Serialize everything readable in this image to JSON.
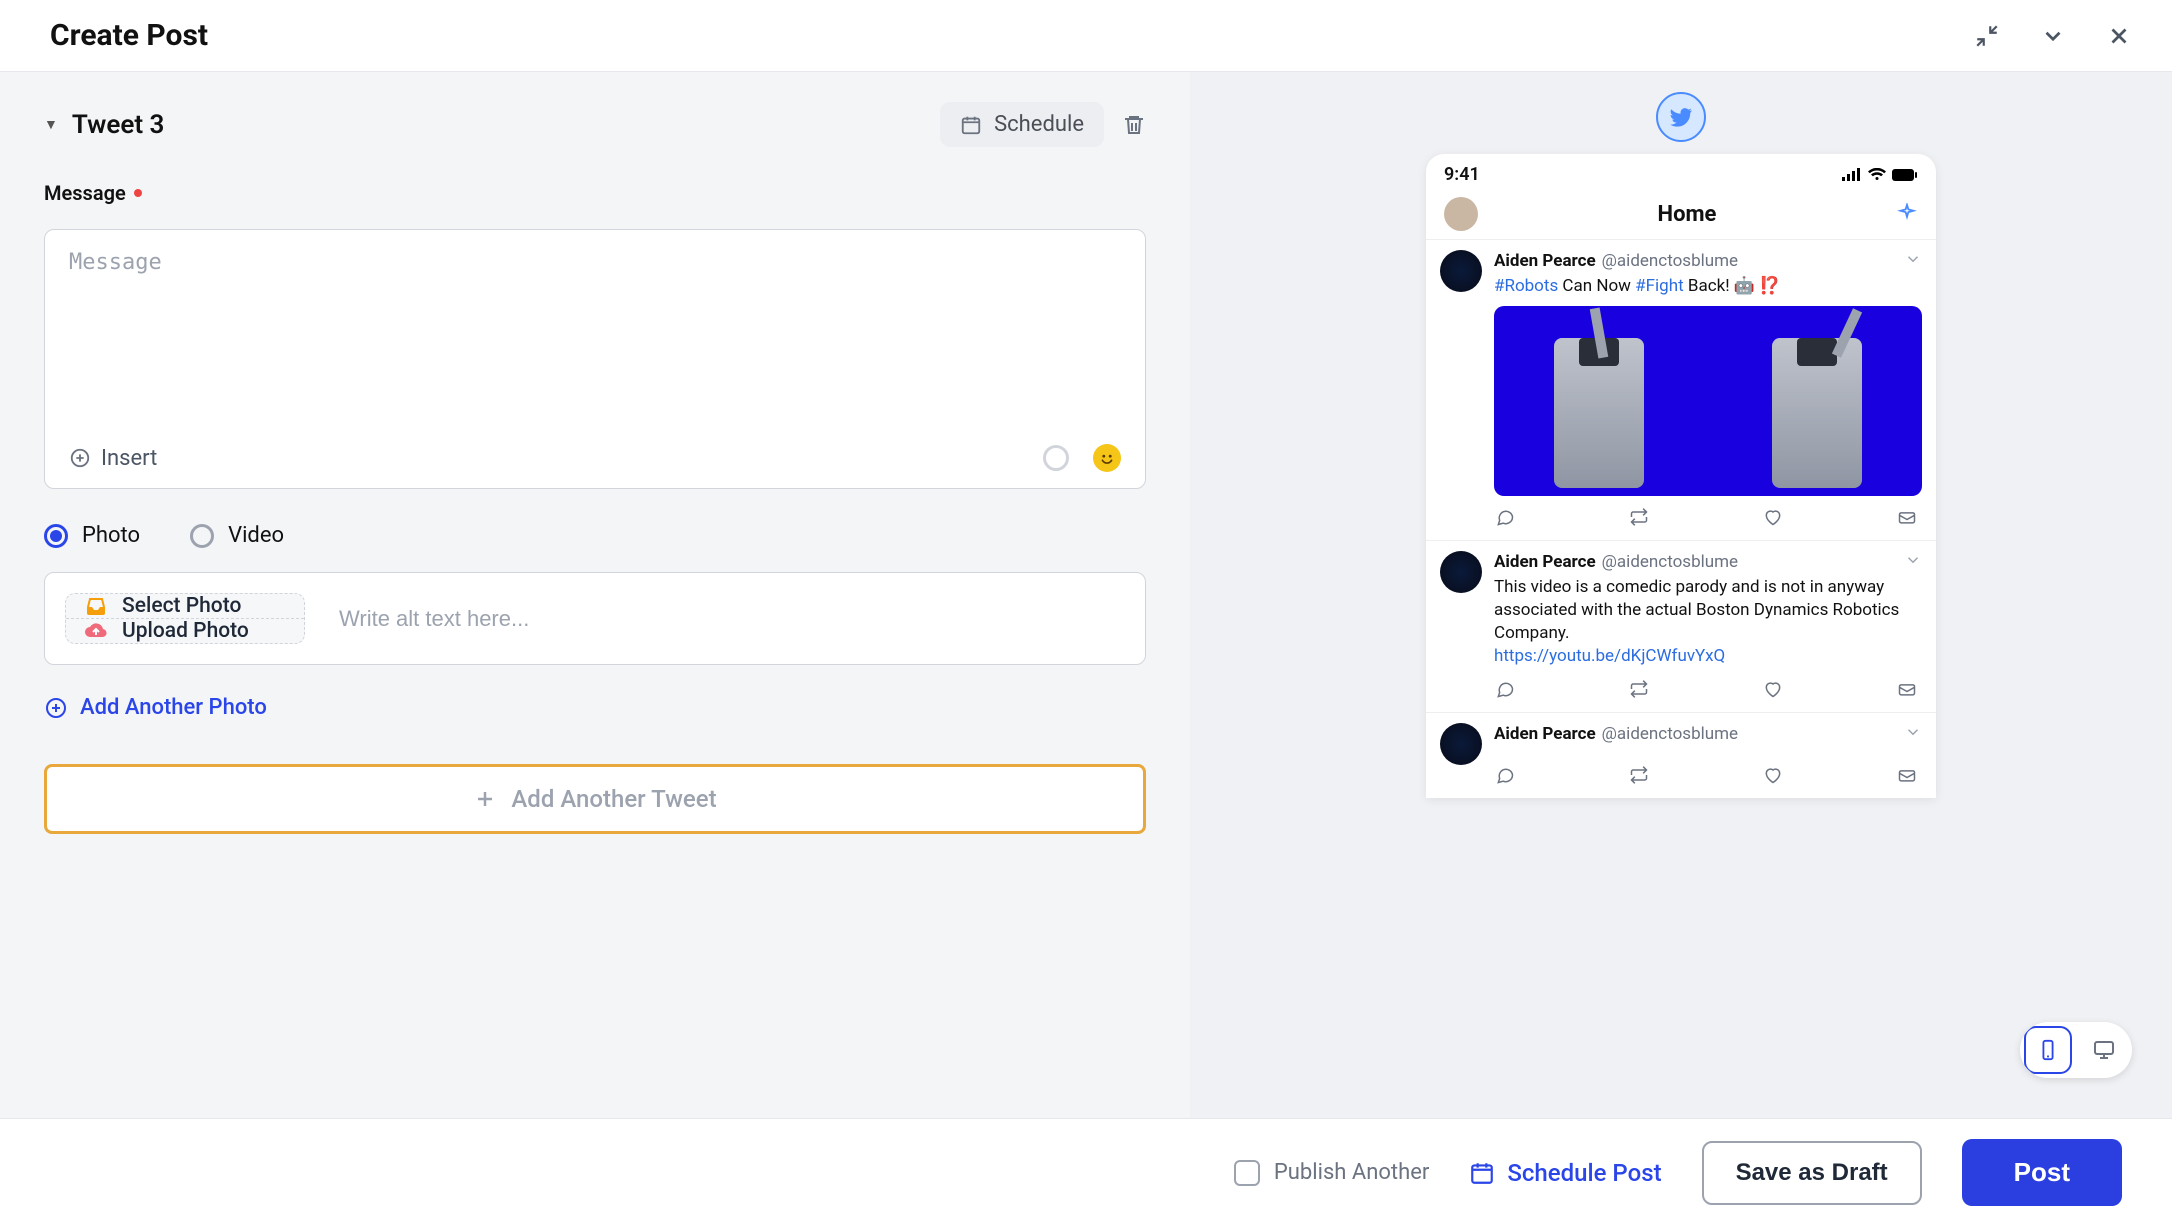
{
  "header": {
    "title": "Create Post"
  },
  "editor": {
    "tweetTitle": "Tweet 3",
    "scheduleLabel": "Schedule",
    "messageLabel": "Message",
    "messagePlaceholder": "Message",
    "insertLabel": "Insert",
    "mediaType": {
      "photo": "Photo",
      "video": "Video"
    },
    "selectPhoto": "Select Photo",
    "uploadPhoto": "Upload Photo",
    "altPlaceholder": "Write alt text here...",
    "addAnotherPhoto": "Add Another Photo",
    "addAnotherTweet": "Add Another Tweet"
  },
  "preview": {
    "time": "9:41",
    "headerTitle": "Home",
    "tweets": [
      {
        "name": "Aiden Pearce",
        "handle": "@aidenctosblume",
        "hashtag1": "#Robots",
        "mid1": " Can Now ",
        "hashtag2": "#Fight",
        "tail": " Back! 🤖 ⁉️"
      },
      {
        "name": "Aiden Pearce",
        "handle": "@aidenctosblume",
        "text": "This video is a comedic parody and is not in anyway associated with the actual Boston Dynamics Robotics Company.",
        "link": "https://youtu.be/dKjCWfuvYxQ"
      },
      {
        "name": "Aiden Pearce",
        "handle": "@aidenctosblume"
      }
    ]
  },
  "footer": {
    "publishAnother": "Publish Another",
    "schedulePost": "Schedule Post",
    "saveDraft": "Save as Draft",
    "post": "Post"
  }
}
